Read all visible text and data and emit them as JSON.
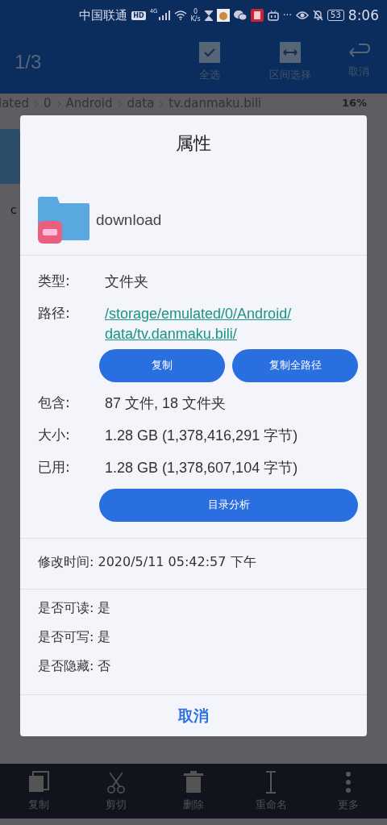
{
  "status_bar": {
    "carrier": "中国联通",
    "hd_badge": "HD",
    "network": "4G",
    "speed_value": "0",
    "speed_unit": "K/s",
    "more": "···",
    "battery": "53",
    "time": "8:06"
  },
  "top_bar": {
    "counter": "1/3",
    "actions": [
      {
        "label": "全选",
        "kind": "check"
      },
      {
        "label": "区间选择",
        "kind": "range"
      },
      {
        "label": "取消",
        "kind": "undo"
      }
    ]
  },
  "breadcrumb": {
    "items": [
      "lated",
      "0",
      "Android",
      "data",
      "tv.danmaku.bili"
    ],
    "storage": "16%"
  },
  "file_tile": {
    "label": "c"
  },
  "dialog": {
    "title": "属性",
    "name": "download",
    "rows": [
      {
        "kind": "text",
        "label": "类型:",
        "value": "文件夹"
      },
      {
        "kind": "link",
        "label": "路径:",
        "value": "/storage/emulated/0/Android/data/tv.danmaku.bili/",
        "buttons": [
          "复制",
          "复制全路径"
        ]
      },
      {
        "kind": "text",
        "label": "包含:",
        "value": "87 文件, 18 文件夹"
      },
      {
        "kind": "text",
        "label": "大小:",
        "value": "1.28 GB (1,378,416,291 字节)"
      },
      {
        "kind": "text",
        "label": "已用:",
        "value": "1.28 GB (1,378,607,104 字节)",
        "buttons": [
          "目录分析"
        ]
      }
    ],
    "modified": "修改时间: 2020/5/11 05:42:57 下午",
    "permissions": [
      "是否可读: 是",
      "是否可写: 是",
      "是否隐藏: 否"
    ],
    "cancel": "取消"
  },
  "bottom_bar": [
    {
      "label": "复制",
      "kind": "copy"
    },
    {
      "label": "剪切",
      "kind": "cut"
    },
    {
      "label": "删除",
      "kind": "trash"
    },
    {
      "label": "重命名",
      "kind": "rename"
    },
    {
      "label": "更多",
      "kind": "more"
    }
  ]
}
